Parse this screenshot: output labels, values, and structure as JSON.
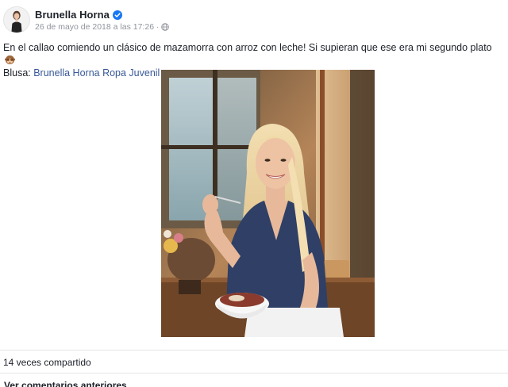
{
  "post": {
    "author": {
      "name": "Brunella Horna",
      "verified": true,
      "avatar_icon": "profile-photo"
    },
    "timestamp": "26 de mayo de 2018 a las 17:26",
    "separator": "·",
    "privacy_icon": "globe-icon",
    "text_main": "En el callao comiendo un clásico de mazamorra con arroz con leche! Si supieran que ese era mi segundo plato",
    "text_emoji": "see-no-evil-monkey",
    "text_line2_prefix": "Blusa: ",
    "text_line2_link": "Brunella Horna Ropa Juvenil",
    "photo_icon": "photo-woman-eating-dessert"
  },
  "footer": {
    "shares": "14 veces compartido",
    "more_comments": "Ver comentarios anteriores"
  },
  "colors": {
    "link": "#385898",
    "text": "#1d2129",
    "meta": "#90949c",
    "verified": "#1877f2",
    "divider": "#e5e6e9"
  }
}
